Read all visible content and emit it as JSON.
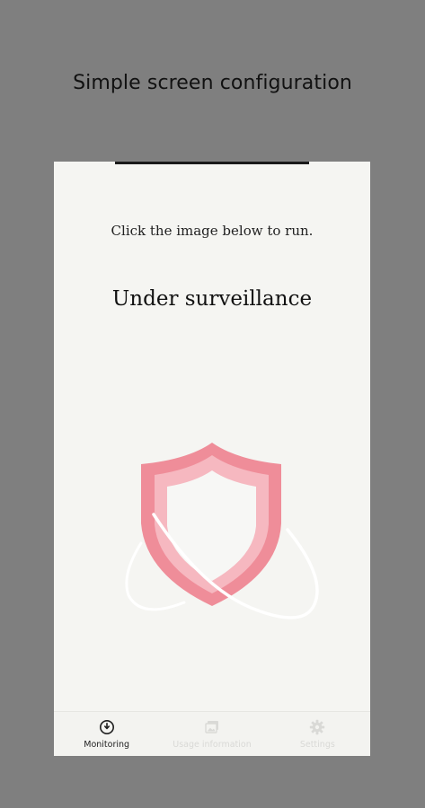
{
  "headline": "Simple screen configuration",
  "main": {
    "instruction": "Click the image below to run.",
    "status": "Under surveillance",
    "shield": {
      "outer_color": "#ef8d99",
      "middle_color": "#f6b8c0",
      "inner_color": "#f7f7f5",
      "orbit_color": "#ffffff",
      "icon": "shield-icon"
    }
  },
  "bottom_nav": {
    "items": [
      {
        "label": "Monitoring",
        "icon": "monitoring-icon",
        "active": true
      },
      {
        "label": "Usage information",
        "icon": "gallery-icon",
        "active": false
      },
      {
        "label": "Settings",
        "icon": "gear-icon",
        "active": false
      }
    ]
  },
  "colors": {
    "background": "#7f7f7f",
    "screen": "#f5f5f2",
    "active_nav": "#1f1f1f",
    "inactive_nav": "#d9d9d6"
  }
}
